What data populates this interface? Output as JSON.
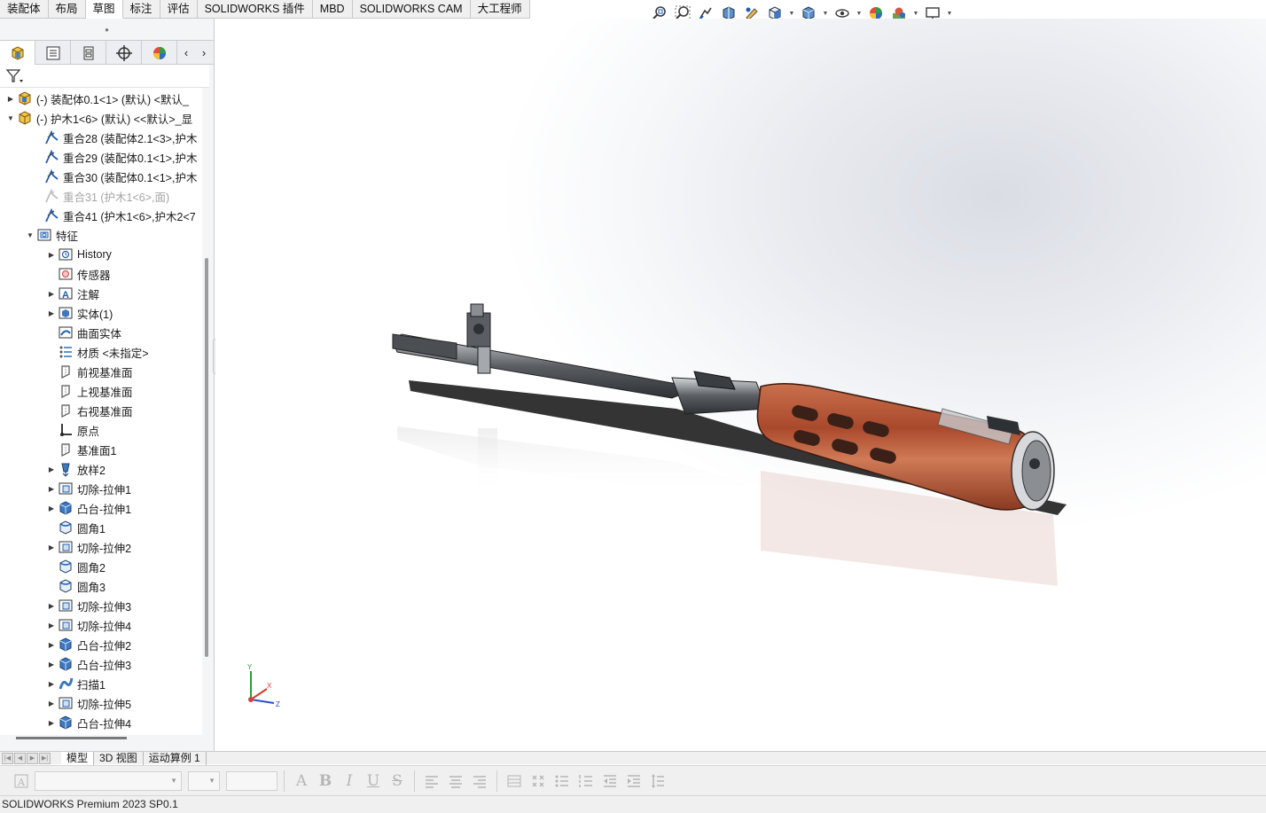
{
  "command_tabs": [
    {
      "label": "装配体"
    },
    {
      "label": "布局"
    },
    {
      "label": "草图"
    },
    {
      "label": "标注"
    },
    {
      "label": "评估"
    },
    {
      "label": "SOLIDWORKS 插件"
    },
    {
      "label": "MBD"
    },
    {
      "label": "SOLIDWORKS CAM"
    },
    {
      "label": "大工程师"
    }
  ],
  "active_command_tab": "草图",
  "heads_up_toolbar": [
    "zoom-to-fit-icon",
    "zoom-to-area-icon",
    "previous-view-icon",
    "section-view-icon",
    "dynamic-annotation-icon",
    "view-orientation-icon",
    "display-style-icon",
    "hide-show-items-icon",
    "edit-appearance-icon",
    "apply-scene-icon",
    "view-settings-icon"
  ],
  "feature_manager_tabs": [
    "featuremanager-tree-icon",
    "propertymanager-icon",
    "configurationmanager-icon",
    "dimxpertmanager-icon",
    "displaymanager-icon"
  ],
  "tree": {
    "top_nodes": [
      {
        "label": "(-) 装配体0.1<1> (默认) <默认_",
        "expanded": false
      },
      {
        "label": "(-) 护木1<6> (默认) <<默认>_显",
        "expanded": true
      }
    ],
    "mates": [
      {
        "label": "重合28 (装配体2.1<3>,护木",
        "suppressed": false
      },
      {
        "label": "重合29 (装配体0.1<1>,护木",
        "suppressed": false
      },
      {
        "label": "重合30 (装配体0.1<1>,护木",
        "suppressed": false
      },
      {
        "label": "重合31 (护木1<6>,面)",
        "suppressed": true
      },
      {
        "label": "重合41 (护木1<6>,护木2<7",
        "suppressed": false
      }
    ],
    "features_folder": "特征",
    "features": [
      {
        "label": "History",
        "icon": "history-icon",
        "expandable": true
      },
      {
        "label": "传感器",
        "icon": "sensor-icon",
        "expandable": false
      },
      {
        "label": "注解",
        "icon": "annotation-icon",
        "expandable": true
      },
      {
        "label": "实体(1)",
        "icon": "solid-bodies-icon",
        "expandable": true
      },
      {
        "label": "曲面实体",
        "icon": "surface-bodies-icon",
        "expandable": false
      },
      {
        "label": "材质 <未指定>",
        "icon": "material-icon",
        "expandable": false
      },
      {
        "label": "前视基准面",
        "icon": "plane-icon",
        "expandable": false
      },
      {
        "label": "上视基准面",
        "icon": "plane-icon",
        "expandable": false
      },
      {
        "label": "右视基准面",
        "icon": "plane-icon",
        "expandable": false
      },
      {
        "label": "原点",
        "icon": "origin-icon",
        "expandable": false
      },
      {
        "label": "基准面1",
        "icon": "plane-icon",
        "expandable": false
      },
      {
        "label": "放样2",
        "icon": "loft-icon",
        "expandable": true
      },
      {
        "label": "切除-拉伸1",
        "icon": "cut-extrude-icon",
        "expandable": true
      },
      {
        "label": "凸台-拉伸1",
        "icon": "boss-extrude-icon",
        "expandable": true
      },
      {
        "label": "圆角1",
        "icon": "fillet-icon",
        "expandable": false
      },
      {
        "label": "切除-拉伸2",
        "icon": "cut-extrude-icon",
        "expandable": true
      },
      {
        "label": "圆角2",
        "icon": "fillet-icon",
        "expandable": false
      },
      {
        "label": "圆角3",
        "icon": "fillet-icon",
        "expandable": false
      },
      {
        "label": "切除-拉伸3",
        "icon": "cut-extrude-icon",
        "expandable": true
      },
      {
        "label": "切除-拉伸4",
        "icon": "cut-extrude-icon",
        "expandable": true
      },
      {
        "label": "凸台-拉伸2",
        "icon": "boss-extrude-icon",
        "expandable": true
      },
      {
        "label": "凸台-拉伸3",
        "icon": "boss-extrude-icon",
        "expandable": true
      },
      {
        "label": "扫描1",
        "icon": "sweep-icon",
        "expandable": true
      },
      {
        "label": "切除-拉伸5",
        "icon": "cut-extrude-icon",
        "expandable": true
      },
      {
        "label": "凸台-拉伸4",
        "icon": "boss-extrude-icon",
        "expandable": true
      }
    ]
  },
  "triad_labels": {
    "x": "X",
    "y": "Y",
    "z": "Z"
  },
  "bottom_tabs": [
    {
      "label": "模型"
    },
    {
      "label": "3D 视图"
    },
    {
      "label": "运动算例 1"
    }
  ],
  "active_bottom_tab": "模型",
  "format_toolbar": {
    "buttons": [
      "A",
      "B",
      "I",
      "U",
      "S"
    ]
  },
  "status_bar": "SOLIDWORKS Premium 2023 SP0.1",
  "colors": {
    "accent_blue": "#1d5fb5",
    "wood": "#a9492c",
    "metal": "#5a5e63"
  }
}
